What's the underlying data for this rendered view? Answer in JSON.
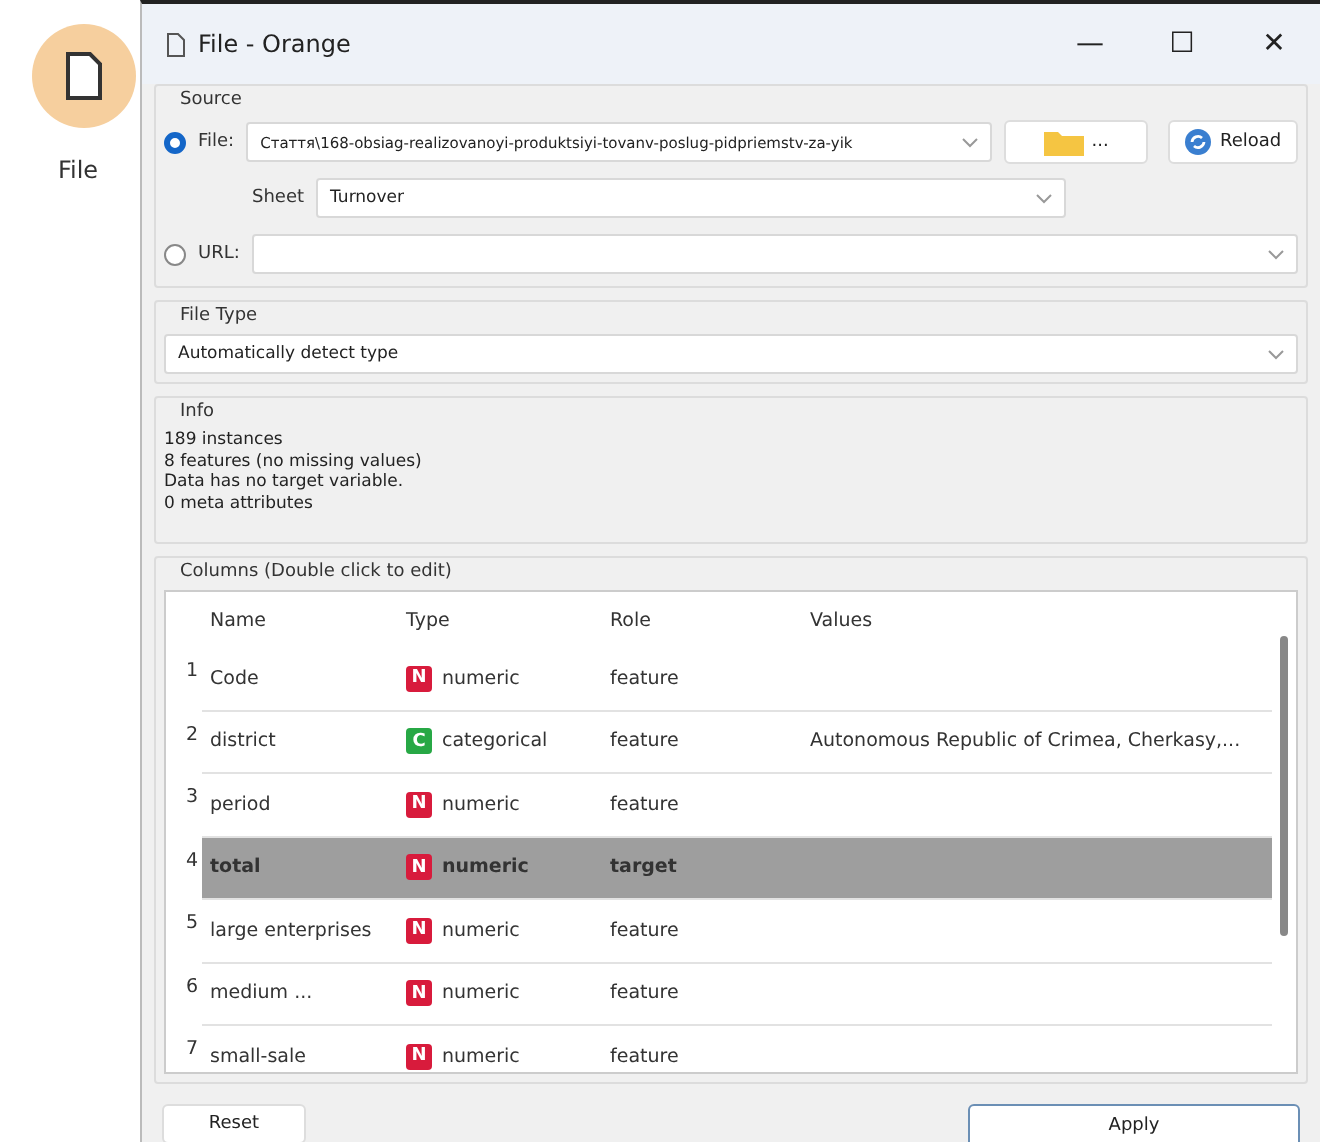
{
  "canvas_node": {
    "label": "File"
  },
  "window": {
    "title": "File - Orange",
    "controls": [
      "—",
      "☐",
      "✕"
    ]
  },
  "source": {
    "title": "Source",
    "file": {
      "label": "File:",
      "selected": true,
      "value": "Стаття\\168-obsiag-realizovanoyi-produktsiyi-tovanv-poslug-pidpriemstv-za-yik",
      "browse": "...",
      "reload": "Reload"
    },
    "sheet": {
      "label": "Sheet",
      "value": "Turnover"
    },
    "url": {
      "label": "URL:",
      "selected": false
    }
  },
  "file_type": {
    "title": "File Type",
    "value": "Automatically detect type"
  },
  "info": {
    "title": "Info",
    "lines": [
      "189 instances",
      "8 features (no missing values)",
      "Data has no target variable.",
      "0 meta attributes"
    ]
  },
  "columns": {
    "title": "Columns (Double click to edit)",
    "headers": [
      "Name",
      "Type",
      "Role",
      "Values"
    ],
    "rows": [
      {
        "index": "1",
        "name": "Code",
        "badge": "N",
        "color": "#d81b3c",
        "type": "numeric",
        "role": "feature",
        "values": "",
        "selected": false
      },
      {
        "index": "2",
        "name": "district",
        "badge": "C",
        "color": "#27a845",
        "type": "categorical",
        "role": "feature",
        "values": "Autonomous Republic of Crimea, Cherkasy,...",
        "selected": false
      },
      {
        "index": "3",
        "name": "period",
        "badge": "N",
        "color": "#d81b3c",
        "type": "numeric",
        "role": "feature",
        "values": "",
        "selected": false
      },
      {
        "index": "4",
        "name": "total",
        "badge": "N",
        "color": "#d81b3c",
        "type": "numeric",
        "role": "target",
        "values": "",
        "selected": true
      },
      {
        "index": "5",
        "name": "large enterprises",
        "badge": "N",
        "color": "#d81b3c",
        "type": "numeric",
        "role": "feature",
        "values": "",
        "selected": false
      },
      {
        "index": "6",
        "name": "medium ...",
        "badge": "N",
        "color": "#d81b3c",
        "type": "numeric",
        "role": "feature",
        "values": "",
        "selected": false
      },
      {
        "index": "7",
        "name": "small-sale",
        "badge": "N",
        "color": "#d81b3c",
        "type": "numeric",
        "role": "feature",
        "values": "",
        "selected": false
      }
    ]
  },
  "buttons": {
    "reset": "Reset",
    "apply": "Apply"
  }
}
